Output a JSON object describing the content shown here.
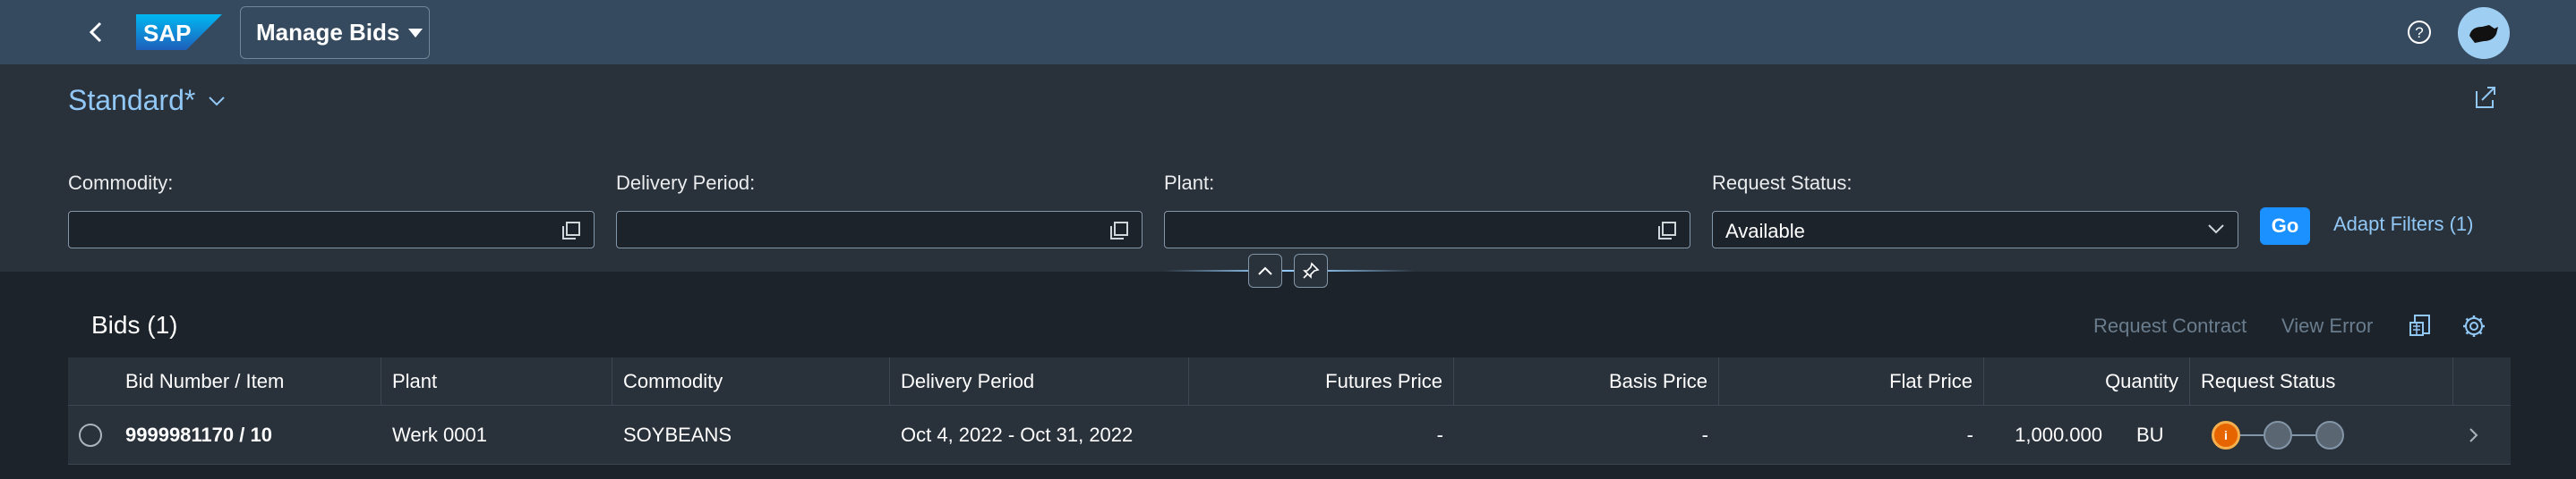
{
  "shell": {
    "app_title": "Manage Bids",
    "logo_text": "SAP"
  },
  "header": {
    "variant": "Standard*"
  },
  "filters": [
    {
      "label": "Commodity:",
      "value": ""
    },
    {
      "label": "Delivery Period:",
      "value": ""
    },
    {
      "label": "Plant:",
      "value": ""
    },
    {
      "label": "Request Status:",
      "value": "Available"
    }
  ],
  "actions": {
    "go": "Go",
    "adapt_filters": "Adapt Filters (1)"
  },
  "table": {
    "title": "Bids (1)",
    "toolbar": {
      "request_contract": "Request Contract",
      "view_error": "View Error"
    },
    "columns": [
      "Bid Number / Item",
      "Plant",
      "Commodity",
      "Delivery Period",
      "Futures Price",
      "Basis Price",
      "Flat Price",
      "Quantity",
      "Request Status"
    ],
    "rows": [
      {
        "bid": "9999981170 / 10",
        "plant": "Werk 0001",
        "commodity": "SOYBEANS",
        "delivery_period": "Oct 4, 2022 - Oct 31, 2022",
        "futures_price": "-",
        "basis_price": "-",
        "flat_price": "-",
        "quantity": "1,000.000",
        "unit": "BU",
        "status_step": "i"
      }
    ]
  },
  "colors": {
    "shell": "#354a5f",
    "accent": "#1b90ff",
    "link": "#91c8f6",
    "status_warning": "#e76500"
  }
}
